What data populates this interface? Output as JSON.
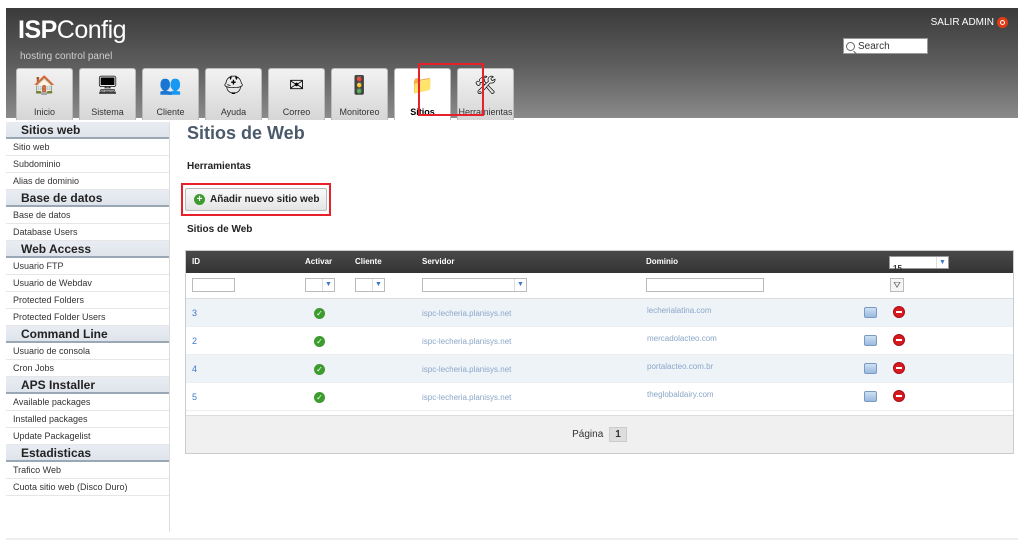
{
  "header": {
    "logo_strong": "ISP",
    "logo_rest": "Config",
    "tagline": "hosting control panel",
    "logout": "SALIR ADMIN",
    "search_placeholder": "Search"
  },
  "tabs": [
    {
      "label": "Inicio",
      "icon": "home-icon"
    },
    {
      "label": "Sistema",
      "icon": "computer-icon"
    },
    {
      "label": "Cliente",
      "icon": "users-icon"
    },
    {
      "label": "Ayuda",
      "icon": "lifebuoy-icon"
    },
    {
      "label": "Correo",
      "icon": "envelope-icon"
    },
    {
      "label": "Monitoreo",
      "icon": "traffic-light-icon"
    },
    {
      "label": "Sitios",
      "icon": "sites-folder-icon"
    },
    {
      "label": "Herramientas",
      "icon": "tools-icon"
    }
  ],
  "sidebar": [
    {
      "title": "Sitios web",
      "items": [
        "Sitio web",
        "Subdominio",
        "Alias de dominio"
      ]
    },
    {
      "title": "Base de datos",
      "items": [
        "Base de datos",
        "Database Users"
      ]
    },
    {
      "title": "Web Access",
      "items": [
        "Usuario FTP",
        "Usuario de Webdav",
        "Protected Folders",
        "Protected Folder Users"
      ]
    },
    {
      "title": "Command Line",
      "items": [
        "Usuario de consola",
        "Cron Jobs"
      ]
    },
    {
      "title": "APS Installer",
      "items": [
        "Available packages",
        "Installed packages",
        "Update Packagelist"
      ]
    },
    {
      "title": "Estadisticas",
      "items": [
        "Trafico Web",
        "Cuota sitio web (Disco Duro)"
      ]
    }
  ],
  "main": {
    "title": "Sitios de Web",
    "tools_label": "Herramientas",
    "add_button": "Añadir nuevo sitio web",
    "list_label": "Sitios de Web",
    "columns": {
      "id": "ID",
      "active": "Activar",
      "client": "Cliente",
      "server": "Servidor",
      "domain": "Dominio"
    },
    "per_page": "15",
    "rows": [
      {
        "id": "3",
        "server": "ispc-lecheria.planisys.net",
        "domain": "lecherialatina.com"
      },
      {
        "id": "2",
        "server": "ispc-lecheria.planisys.net",
        "domain": "mercadolacteo.com"
      },
      {
        "id": "4",
        "server": "ispc-lecheria.planisys.net",
        "domain": "portalacteo.com.br"
      },
      {
        "id": "5",
        "server": "ispc-lecheria.planisys.net",
        "domain": "theglobaldairy.com"
      }
    ],
    "pager_label": "Página",
    "page": "1"
  },
  "colors": {
    "accent": "#3e79c8",
    "highlight": "#e8202a",
    "active_green": "#3d9b2f",
    "delete_red": "#d8191f"
  }
}
